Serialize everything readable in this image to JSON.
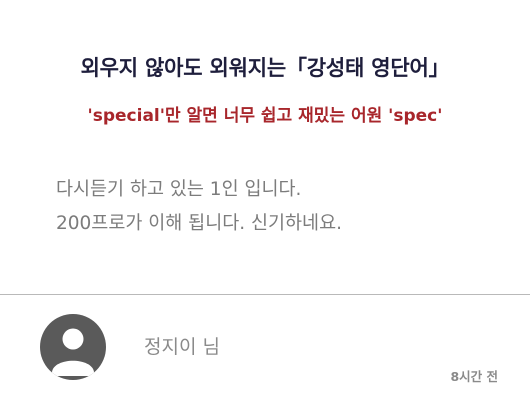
{
  "review_card": {
    "title": "외우지 않아도 외워지는「강성태 영단어」",
    "subtitle": "'special'만 알면 너무 쉽고 재밌는 어원 'spec'",
    "review_lines": [
      "다시듣기 하고 있는 1인 입니다.",
      "200프로가 이해 됩니다. 신기하네요."
    ],
    "author": {
      "avatar_icon": "user-avatar-icon",
      "name": "정지이 님"
    },
    "timestamp": "8시간 전"
  },
  "colors": {
    "title": "#1e1e3c",
    "subtitle": "#a8262b",
    "body_text": "#7c7c7c",
    "meta_text": "#8a8a8a",
    "avatar": "#5a5a5a",
    "divider": "#b9b9b9"
  }
}
